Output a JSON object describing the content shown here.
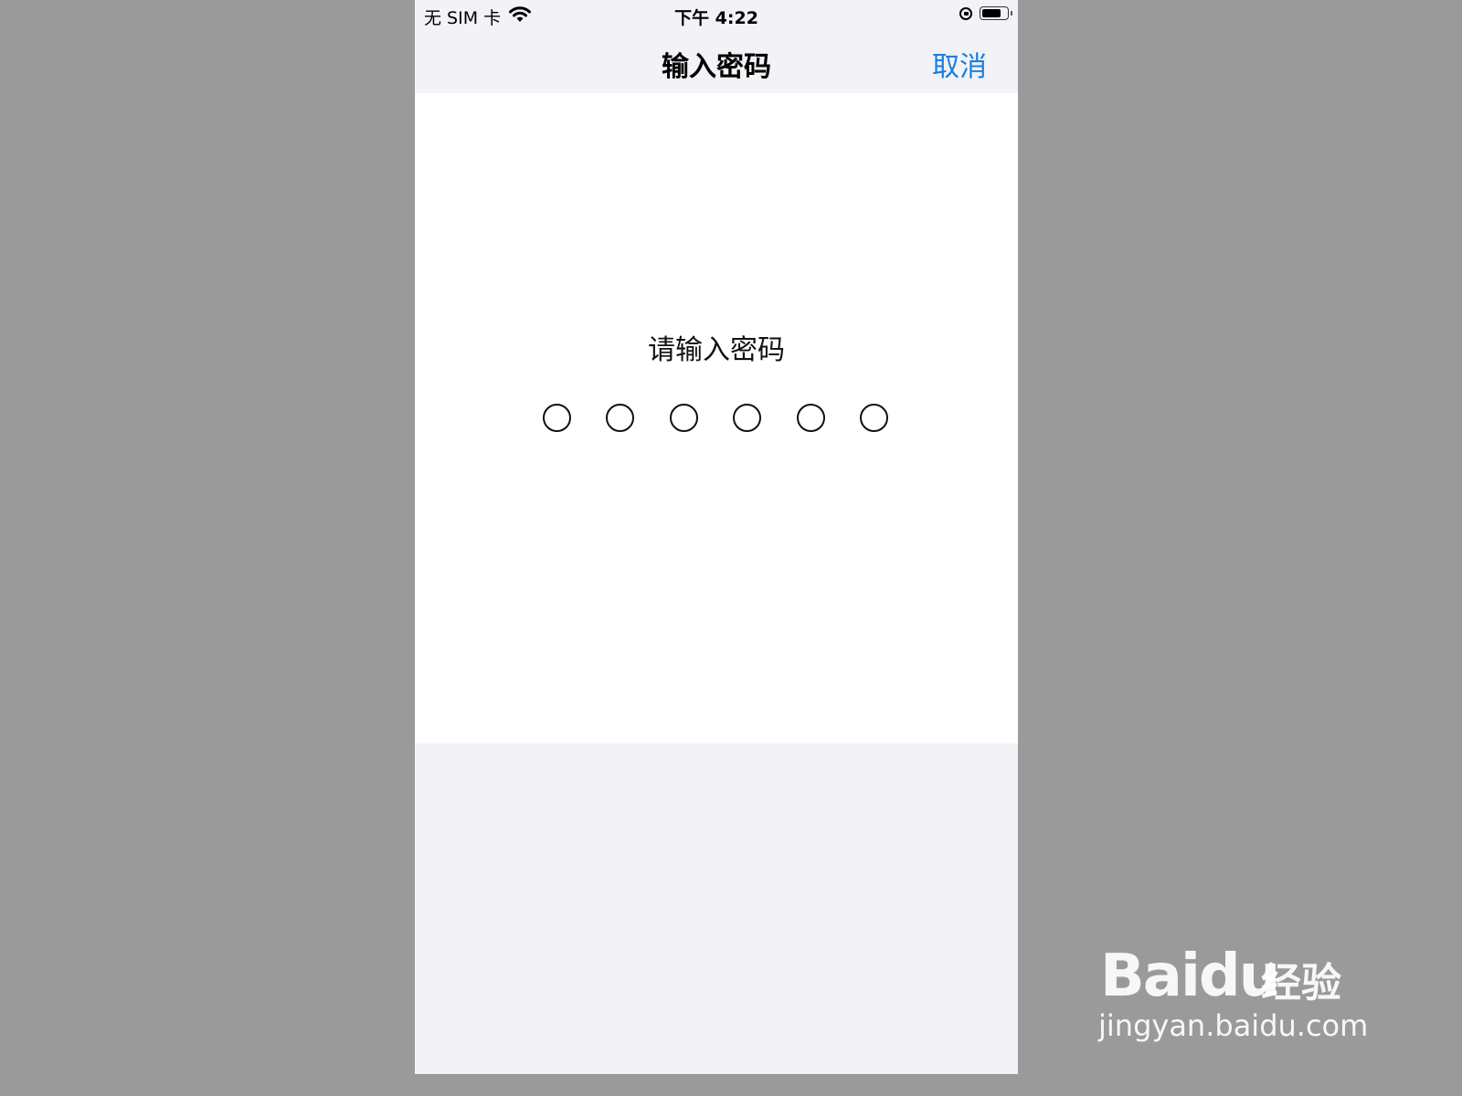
{
  "status_bar": {
    "carrier": "无 SIM 卡",
    "time": "下午 4:22",
    "battery_level": 0.8,
    "icons": [
      "wifi-icon",
      "rotation-lock-icon",
      "battery-icon"
    ]
  },
  "nav": {
    "title": "输入密码",
    "cancel_label": "取消"
  },
  "content": {
    "prompt": "请输入密码",
    "pin_length": 6,
    "pin_filled": 0
  },
  "watermark": {
    "logo_text": "Baidu经验",
    "brand": "Bai",
    "brand_du": "du",
    "brand_jy": "经验",
    "url": "jingyan.baidu.com"
  },
  "colors": {
    "accent": "#1a7fe0",
    "backdrop": "#9a9a9a",
    "nav_bg": "#f2f2f7",
    "content_bg": "#ffffff"
  }
}
